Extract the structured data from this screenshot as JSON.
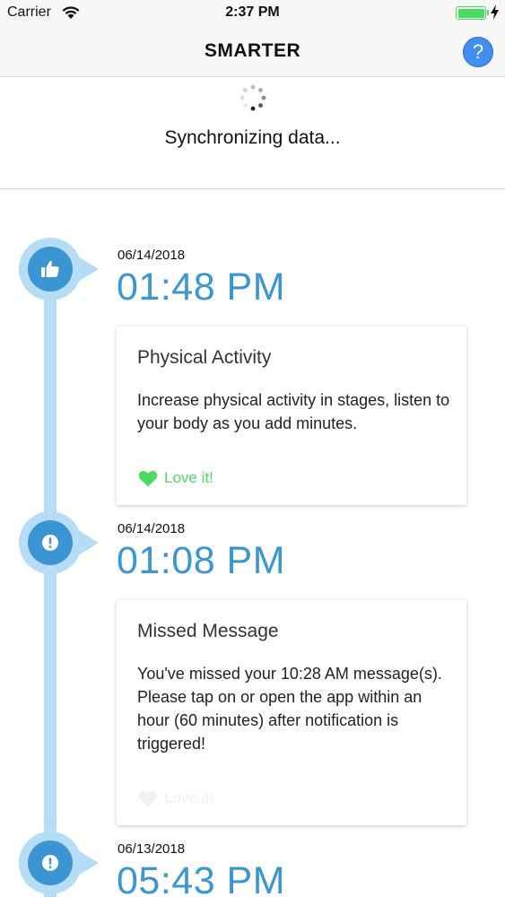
{
  "status_bar": {
    "carrier": "Carrier",
    "time": "2:37 PM",
    "battery_level": 1.0,
    "charging": true
  },
  "nav": {
    "title": "SMARTER",
    "help_label": "?"
  },
  "sync": {
    "message": "Synchronizing data..."
  },
  "timeline": [
    {
      "date": "06/14/2018",
      "time": "01:48 PM",
      "icon": "thumbs-up-icon",
      "card": {
        "title": "Physical Activity",
        "body": "Increase physical activity in stages, listen to your body as you add minutes.",
        "love_label": "Love it!",
        "love_state": "active"
      }
    },
    {
      "date": "06/14/2018",
      "time": "01:08 PM",
      "icon": "exclamation-icon",
      "card": {
        "title": "Missed Message",
        "body": "You've missed your 10:28 AM message(s). Please tap on or open the app within an hour (60 minutes) after notification is triggered!",
        "love_label": "Love it!",
        "love_state": "disabled"
      }
    },
    {
      "date": "06/13/2018",
      "time": "05:43 PM",
      "icon": "exclamation-icon"
    }
  ],
  "colors": {
    "accent": "#3c96cf",
    "timeline_line": "#b7dcf6",
    "node_dark": "#3a95d2",
    "love_green": "#4cd964",
    "help_blue": "#3f8ef0"
  }
}
